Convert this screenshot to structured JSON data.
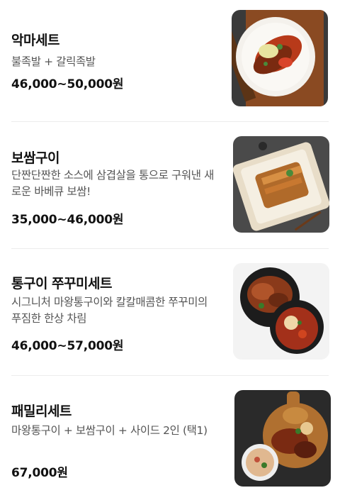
{
  "menu": {
    "items": [
      {
        "name": "악마세트",
        "description": "불족발 + 갈릭족발",
        "price": "46,000~50,000원",
        "image_icon": "spicy-jokbal-plate-photo"
      },
      {
        "name": "보쌈구이",
        "description": "단짠단짠한 소스에 삼겹살을 통으로 구워낸 새로운 바베큐 보쌈!",
        "price": "35,000~46,000원",
        "image_icon": "grilled-bossam-tray-photo"
      },
      {
        "name": "통구이 쭈꾸미세트",
        "description": "시그니처 마왕통구이와 칼칼매콤한 쭈꾸미의 푸짐한 한상 차림",
        "price": "46,000~57,000원",
        "image_icon": "pork-and-webfoot-octopus-photo"
      },
      {
        "name": "패밀리세트",
        "description": "마왕통구이 + 보쌈구이 + 사이드 2인 (택1)",
        "price": "67,000원",
        "image_icon": "family-set-board-photo"
      }
    ]
  }
}
